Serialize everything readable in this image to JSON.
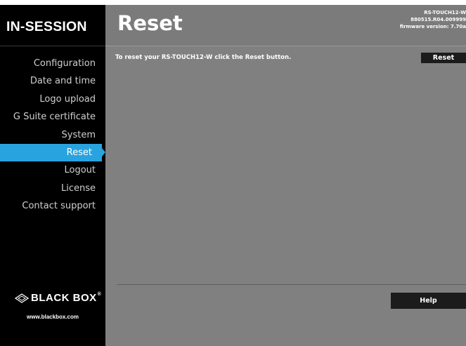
{
  "brand": {
    "name": "IN-SESSION"
  },
  "header": {
    "title": "Reset",
    "device_model": "RS-TOUCH12-W",
    "device_serial": "880515.R04.009999",
    "firmware": "firmware version: 7.70a"
  },
  "sidebar": {
    "items": [
      {
        "label": "Configuration",
        "active": false
      },
      {
        "label": "Date and time",
        "active": false
      },
      {
        "label": "Logo upload",
        "active": false
      },
      {
        "label": "G Suite certificate",
        "active": false
      },
      {
        "label": "System",
        "active": false
      },
      {
        "label": "Reset",
        "active": true
      },
      {
        "label": "Logout",
        "active": false
      },
      {
        "label": "License",
        "active": false
      },
      {
        "label": "Contact support",
        "active": false
      }
    ],
    "logo_text": "BLACK BOX",
    "logo_reg": "®",
    "url": "www.blackbox.com"
  },
  "main": {
    "instruction": "To reset your RS-TOUCH12-W click the Reset button.",
    "reset_button_label": "Reset",
    "help_button_label": "Help"
  },
  "colors": {
    "sidebar_bg": "#000000",
    "header_bg": "#7b7b7b",
    "main_bg": "#808080",
    "accent_active": "#29a3e0",
    "button_bg": "#1c1c1c"
  }
}
